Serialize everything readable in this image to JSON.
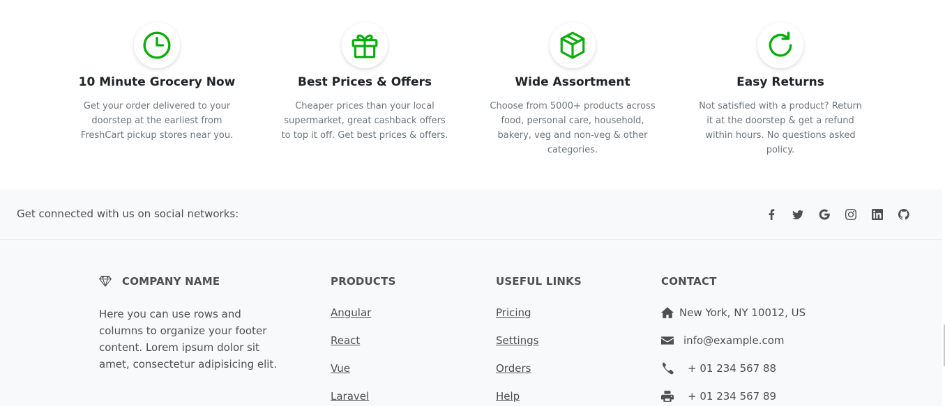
{
  "features": [
    {
      "icon": "clock-icon",
      "title": "10 Minute Grocery Now",
      "desc": "Get your order delivered to your doorstep at the earliest from FreshCart pickup stores near you."
    },
    {
      "icon": "gift-icon",
      "title": "Best Prices & Offers",
      "desc": "Cheaper prices than your local supermarket, great cashback offers to top it off. Get best prices & offers."
    },
    {
      "icon": "box-icon",
      "title": "Wide Assortment",
      "desc": "Choose from 5000+ products across food, personal care, household, bakery, veg and non-veg & other categories."
    },
    {
      "icon": "refresh-icon",
      "title": "Easy Returns",
      "desc": "Not satisfied with a product? Return it at the doorstep & get a refund within hours. No questions asked policy."
    }
  ],
  "accent_color": "#0aad0a",
  "social": {
    "text": "Get connected with us on social networks:",
    "icons": [
      "facebook-icon",
      "twitter-icon",
      "google-icon",
      "instagram-icon",
      "linkedin-icon",
      "github-icon"
    ]
  },
  "footer": {
    "company": {
      "title": "COMPANY NAME",
      "icon": "gem-icon",
      "desc": "Here you can use rows and columns to organize your footer content. Lorem ipsum dolor sit amet, consectetur adipisicing elit."
    },
    "products": {
      "title": "PRODUCTS",
      "links": [
        "Angular",
        "React",
        "Vue",
        "Laravel"
      ]
    },
    "useful": {
      "title": "USEFUL LINKS",
      "links": [
        "Pricing",
        "Settings",
        "Orders",
        "Help"
      ]
    },
    "contact": {
      "title": "CONTACT",
      "address": "New York, NY 10012, US",
      "email": "info@example.com",
      "phone": "+ 01 234 567 88",
      "fax": "+ 01 234 567 89"
    }
  }
}
